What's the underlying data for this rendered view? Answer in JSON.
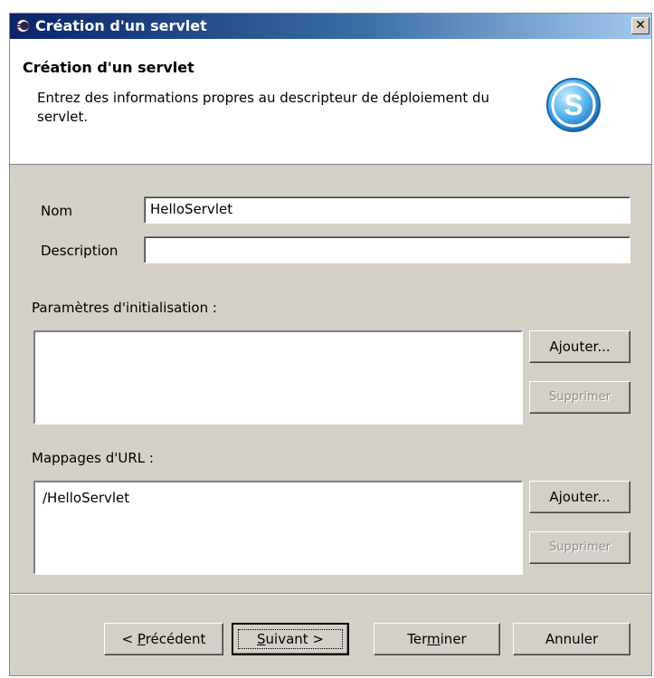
{
  "window": {
    "title": "Création d'un servlet",
    "close_label": "✕"
  },
  "header": {
    "title": "Création d'un servlet",
    "description": "Entrez des informations propres au descripteur de déploiement du servlet."
  },
  "form": {
    "name_label": "Nom",
    "name_value": "HelloServlet",
    "description_label": "Description",
    "description_value": ""
  },
  "init_params": {
    "label": "Paramètres d'initialisation :",
    "items": [],
    "add_label": "Ajouter...",
    "remove_label": "Supprimer"
  },
  "url_mappings": {
    "label": "Mappages d'URL :",
    "items": [
      "/HelloServlet"
    ],
    "add_label": "Ajouter...",
    "remove_label": "Supprimer"
  },
  "footer": {
    "back_prefix": "< ",
    "back_mnemonic": "P",
    "back_rest": "récédent",
    "next_mnemonic": "S",
    "next_rest": "uivant >",
    "finish_pre": "Ter",
    "finish_mnemonic": "m",
    "finish_post": "iner",
    "cancel_label": "Annuler"
  },
  "colors": {
    "titlebar_start": "#0a246a",
    "titlebar_end": "#a6caf0",
    "dialog_bg": "#d4d0c8",
    "logo_blue": "#2a8fd8"
  },
  "icons": {
    "title": "eclipse-icon",
    "logo": "servlet-s-logo"
  }
}
